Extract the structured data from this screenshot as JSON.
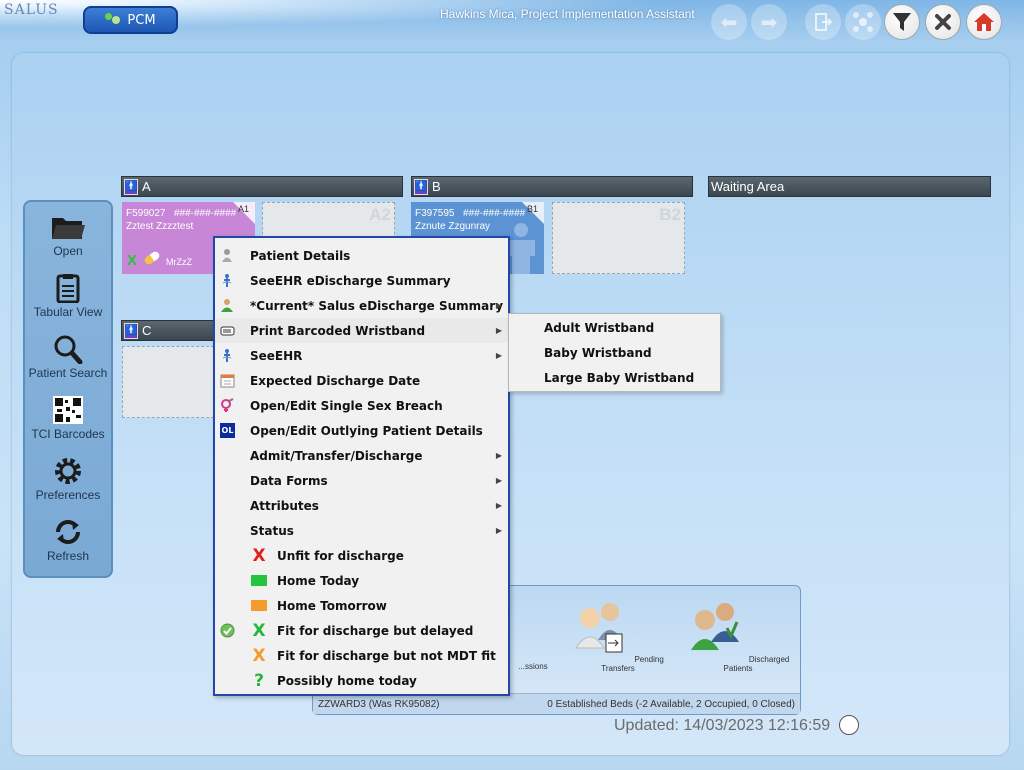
{
  "app": {
    "logo_text": "SALUS",
    "logo_tagline": "",
    "module_button": "PCM",
    "user_label": "Hawkins Mica, Project Implementation Assistant"
  },
  "toolbar": {
    "back_icon": "arrow-left-icon",
    "forward_icon": "arrow-right-icon",
    "exit_icon": "exit-door-icon",
    "network_icon": "network-icon",
    "filter_icon": "funnel-icon",
    "close_icon": "close-x-icon",
    "home_icon": "home-icon"
  },
  "sidebar": {
    "items": [
      {
        "label": "Open",
        "icon": "folder-icon"
      },
      {
        "label": "Tabular View",
        "icon": "clipboard-icon"
      },
      {
        "label": "Patient Search",
        "icon": "magnifier-icon"
      },
      {
        "label": "TCI Barcodes",
        "icon": "qr-code-icon"
      },
      {
        "label": "Preferences",
        "icon": "gear-icon"
      },
      {
        "label": "Refresh",
        "icon": "refresh-icon"
      }
    ]
  },
  "bays": {
    "a": {
      "label": "A"
    },
    "b": {
      "label": "B"
    },
    "c": {
      "label": "C"
    },
    "waiting": {
      "label": "Waiting Area"
    }
  },
  "beds": {
    "a1": {
      "bed_no": "A1",
      "patient_id": "F599027",
      "nhs": "###-###-####",
      "name": "Zztest Zzzztest",
      "consultant": "MrZzZ",
      "color": "#c886d6"
    },
    "a2": {
      "bed_no": "A2"
    },
    "b1": {
      "bed_no": "B1",
      "patient_id": "F397595",
      "nhs": "###-###-####",
      "name": "Zznute Zzgunray",
      "color": "#5c93d2"
    },
    "b2": {
      "bed_no": "B2"
    }
  },
  "context_menu": {
    "items": [
      {
        "label": "Patient Details",
        "icon": "person-icon",
        "submenu": false
      },
      {
        "label": "SeeEHR eDischarge Summary",
        "icon": "ehr-icon",
        "submenu": false
      },
      {
        "label": "*Current* Salus eDischarge Summary",
        "icon": "doctor-icon",
        "submenu": true
      },
      {
        "label": "Print Barcoded Wristband",
        "icon": "wristband-icon",
        "submenu": true
      },
      {
        "label": "SeeEHR",
        "icon": "ehr-icon",
        "submenu": true
      },
      {
        "label": "Expected Discharge Date",
        "icon": "calendar-icon",
        "submenu": false
      },
      {
        "label": "Open/Edit Single Sex Breach",
        "icon": "gender-icon",
        "submenu": false
      },
      {
        "label": "Open/Edit Outlying Patient Details",
        "icon": "outlier-icon",
        "icon_text": "OL",
        "submenu": false
      },
      {
        "label": "Admit/Transfer/Discharge",
        "submenu": true
      },
      {
        "label": "Data Forms",
        "submenu": true
      },
      {
        "label": "Attributes",
        "submenu": true
      },
      {
        "label": "Status",
        "submenu": true
      },
      {
        "label": "Unfit for discharge",
        "symbol": "X",
        "symbol_color": "#e0201b"
      },
      {
        "label": "Home Today",
        "symbol_color": "#27c33b"
      },
      {
        "label": "Home Tomorrow",
        "symbol_color": "#f59b2c"
      },
      {
        "label": "Fit for discharge but delayed",
        "symbol": "X",
        "symbol_color": "#22b83a",
        "checked": true
      },
      {
        "label": "Fit for discharge but not MDT fit",
        "symbol": "X",
        "symbol_color": "#f59b2c"
      },
      {
        "label": "Possibly home today",
        "symbol": "?",
        "symbol_color": "#28b535"
      }
    ]
  },
  "submenu": {
    "items": [
      "Adult Wristband",
      "Baby Wristband",
      "Large Baby Wristband"
    ]
  },
  "bottom_panel": {
    "items": [
      {
        "label": "...ssions"
      },
      {
        "label": "Pending Transfers"
      },
      {
        "label": "Discharged Patients"
      }
    ],
    "ward": "ZZWARD3 (Was RK95082)",
    "beds_summary": "0 Established Beds (-2 Available, 2 Occupied, 0 Closed)"
  },
  "status": {
    "updated": "Updated: 14/03/2023 12:16:59"
  }
}
